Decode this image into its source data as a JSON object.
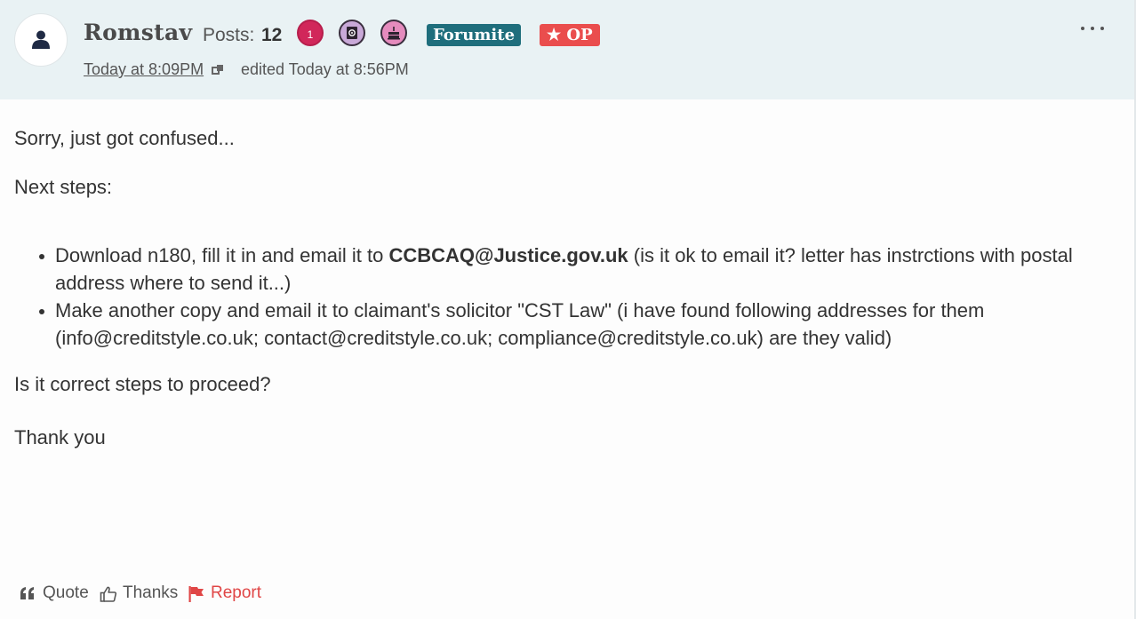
{
  "author": {
    "name": "Romstav",
    "posts_label": "Posts:",
    "posts_count": "12",
    "badge_count": "1",
    "avatar_icon": "user-icon",
    "badges": [
      "count-badge",
      "notebook-badge",
      "birthday-cake-badge"
    ],
    "role_tag": "Forumite",
    "op_tag": "★ OP"
  },
  "meta": {
    "timestamp": "Today at 8:09PM",
    "edited": "edited Today at 8:56PM"
  },
  "body": {
    "p1": "Sorry, just got confused...",
    "p2": "Next steps:",
    "list": [
      {
        "pre": "Download n180, fill it in and email it to ",
        "bold": "CCBCAQ@Justice.gov.uk",
        "post": " (is it ok to email it? letter has instrctions with postal address where to send it...)"
      },
      {
        "pre": "Make another copy and email it to claimant's solicitor \"CST Law\" (i have found following addresses for them (info@creditstyle.co.uk; contact@creditstyle.co.uk; compliance@creditstyle.co.uk) are they valid)",
        "bold": "",
        "post": ""
      }
    ],
    "p3": "Is it correct steps to proceed?",
    "p4": "Thank you"
  },
  "reactions": {
    "quote": "Quote",
    "thanks": "Thanks",
    "report": "Report"
  },
  "colors": {
    "header_bg": "#e9f2f4",
    "forumite_tag": "#1f6e7c",
    "op_tag": "#ea4d4d",
    "report": "#e04646"
  }
}
